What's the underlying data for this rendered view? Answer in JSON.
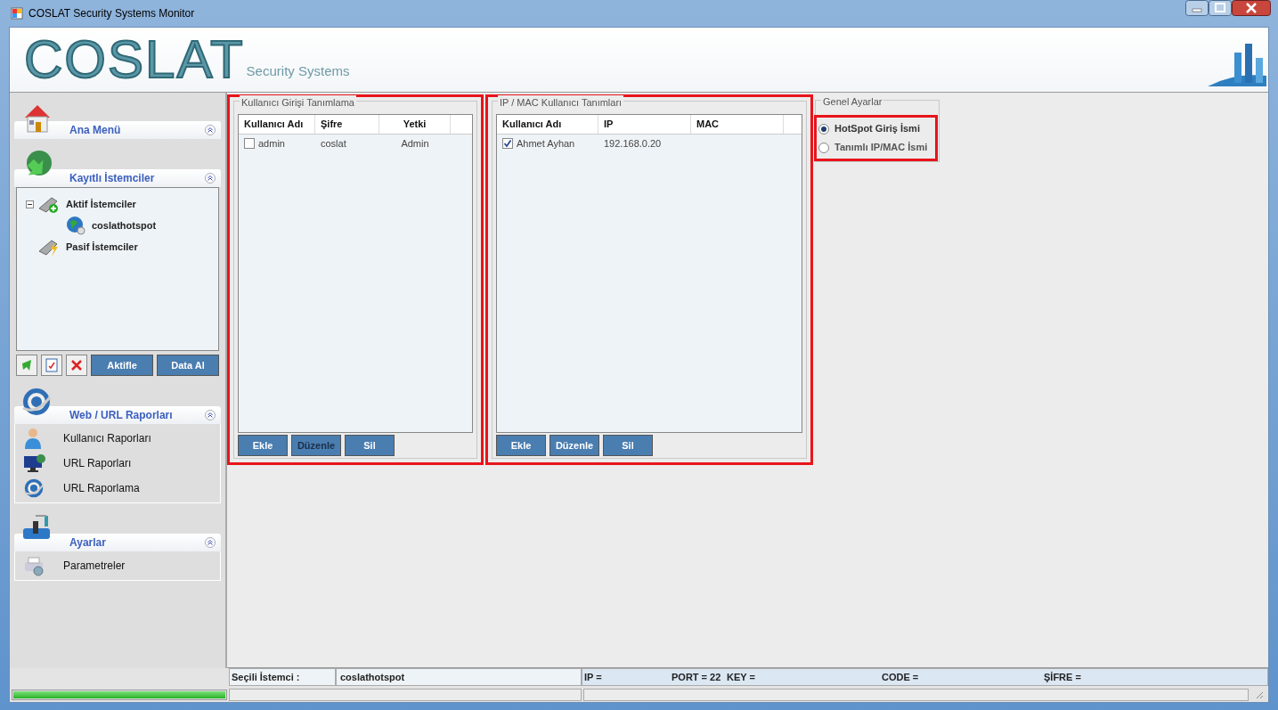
{
  "window": {
    "title": "COSLAT Security Systems Monitor"
  },
  "logo": {
    "name": "COSLAT",
    "tagline": "Security Systems"
  },
  "sidebar": {
    "sections": [
      {
        "title": "Ana Menü",
        "kind": "empty"
      },
      {
        "title": "Kayıtlı İstemciler",
        "kind": "tree",
        "tree": [
          {
            "label": "Aktif İstemciler",
            "expanded": true,
            "children": [
              {
                "label": "coslathotspot"
              }
            ]
          },
          {
            "label": "Pasif İstemciler"
          }
        ],
        "buttons": [
          "Aktifle",
          "Data Al"
        ]
      },
      {
        "title": "Web / URL Raporları",
        "kind": "list",
        "items": [
          {
            "label": "Kullanıcı Raporları"
          },
          {
            "label": "URL Raporları"
          },
          {
            "label": "URL Raporlama"
          }
        ]
      },
      {
        "title": "Ayarlar",
        "kind": "list",
        "items": [
          {
            "label": "Parametreler"
          }
        ]
      }
    ]
  },
  "panels": [
    {
      "title": "Kullanıcı Girişi Tanımlama",
      "highlighted": true,
      "columns": [
        "Kullanıcı Adı",
        "Şifre",
        "Yetki"
      ],
      "rows": [
        {
          "checked": false,
          "cells": [
            "admin",
            "coslat",
            "Admin"
          ]
        }
      ],
      "buttons": [
        {
          "label": "Ekle",
          "disabled": false
        },
        {
          "label": "Düzenle",
          "disabled": true
        },
        {
          "label": "Sil",
          "disabled": false
        }
      ]
    },
    {
      "title": "IP / MAC Kullanıcı Tanımları",
      "highlighted": true,
      "columns": [
        "Kullanıcı Adı",
        "IP",
        "MAC"
      ],
      "rows": [
        {
          "checked": true,
          "cells": [
            "Ahmet Ayhan",
            "192.168.0.20",
            ""
          ]
        }
      ],
      "buttons": [
        {
          "label": "Ekle",
          "disabled": false
        },
        {
          "label": "Düzenle",
          "disabled": false
        },
        {
          "label": "Sil",
          "disabled": false
        }
      ]
    }
  ],
  "general_settings": {
    "title": "Genel Ayarlar",
    "highlighted": true,
    "options": [
      {
        "label": "HotSpot Giriş İsmi",
        "selected": true
      },
      {
        "label": "Tanımlı IP/MAC İsmi",
        "selected": false
      }
    ]
  },
  "status_bar": {
    "label": "Seçili İstemci :",
    "client": "coslathotspot",
    "ip": "IP =",
    "port": "PORT = 22",
    "key": "KEY =",
    "code": "CODE =",
    "password": "ŞİFRE ="
  },
  "progress": {
    "level": 1
  }
}
